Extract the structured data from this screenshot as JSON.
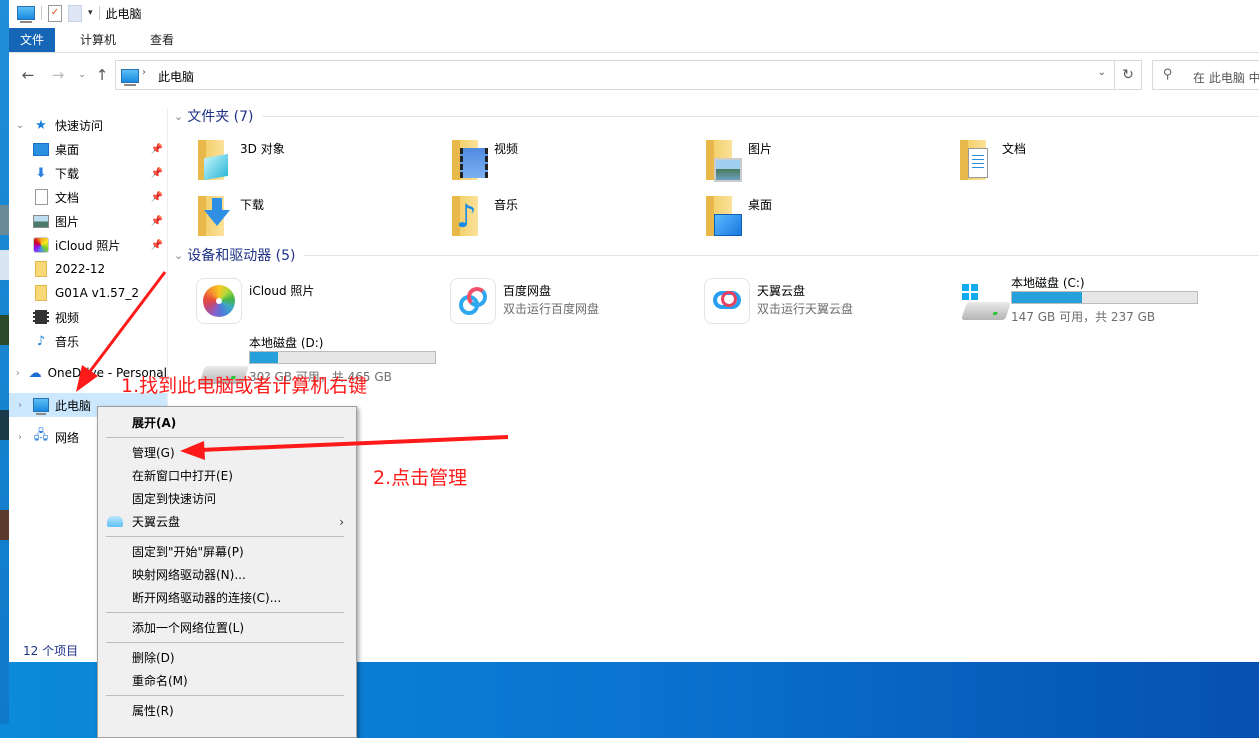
{
  "window": {
    "title": "此电脑",
    "ribbon_tabs": [
      "文件",
      "计算机",
      "查看"
    ]
  },
  "address_bar": {
    "location": "此电脑",
    "search_placeholder": "在 此电脑 中"
  },
  "sidebar": {
    "quick_access": "快速访问",
    "quick_items": [
      {
        "label": "桌面",
        "icon": "desktop-icon",
        "pinned": true
      },
      {
        "label": "下载",
        "icon": "download-icon",
        "pinned": true
      },
      {
        "label": "文档",
        "icon": "document-icon",
        "pinned": true
      },
      {
        "label": "图片",
        "icon": "pictures-icon",
        "pinned": true
      },
      {
        "label": "iCloud 照片",
        "icon": "icloud-photos-icon",
        "pinned": true
      },
      {
        "label": "2022-12",
        "icon": "folder-icon",
        "pinned": false
      },
      {
        "label": "G01A v1.57_2",
        "icon": "folder-icon",
        "pinned": false
      },
      {
        "label": "视频",
        "icon": "video-icon",
        "pinned": false
      },
      {
        "label": "音乐",
        "icon": "music-icon",
        "pinned": false
      }
    ],
    "onedrive": "OneDrive - Personal",
    "this_pc": "此电脑",
    "network": "网络"
  },
  "content": {
    "folders_header": "文件夹 (7)",
    "folders": [
      {
        "name": "3D 对象",
        "overlay": "3d-objects-icon"
      },
      {
        "name": "视频",
        "overlay": "video-icon"
      },
      {
        "name": "图片",
        "overlay": "pictures-icon"
      },
      {
        "name": "文档",
        "overlay": "document-icon"
      },
      {
        "name": "下载",
        "overlay": "download-icon"
      },
      {
        "name": "音乐",
        "overlay": "music-icon"
      },
      {
        "name": "桌面",
        "overlay": "desktop-icon"
      }
    ],
    "devices_header": "设备和驱动器 (5)",
    "devices": [
      {
        "name": "iCloud 照片",
        "sub": ""
      },
      {
        "name": "百度网盘",
        "sub": "双击运行百度网盘"
      },
      {
        "name": "天翼云盘",
        "sub": "双击运行天翼云盘"
      }
    ],
    "drives": [
      {
        "name": "本地磁盘 (C:)",
        "free_text": "147 GB 可用，共 237 GB",
        "used_fraction": 0.38
      },
      {
        "name": "本地磁盘 (D:)",
        "free_text": "30? GB 可用，共 465 GB",
        "used_fraction": 0.15
      }
    ]
  },
  "status_bar": {
    "count": "12 个项目"
  },
  "context_menu": {
    "items": [
      {
        "label": "展开(A)",
        "bold": true
      },
      {
        "label": "管理(G)"
      },
      {
        "label": "在新窗口中打开(E)"
      },
      {
        "label": "固定到快速访问"
      },
      {
        "label": "天翼云盘",
        "submenu": true
      },
      {
        "label": "固定到\"开始\"屏幕(P)"
      },
      {
        "label": "映射网络驱动器(N)..."
      },
      {
        "label": "断开网络驱动器的连接(C)..."
      },
      {
        "label": "添加一个网络位置(L)"
      },
      {
        "label": "删除(D)"
      },
      {
        "label": "重命名(M)"
      },
      {
        "label": "属性(R)"
      }
    ]
  },
  "annotations": {
    "step1": "1.找到此电脑或者计算机右键",
    "step2": "2.点击管理",
    "color": "#ff1a1a"
  }
}
